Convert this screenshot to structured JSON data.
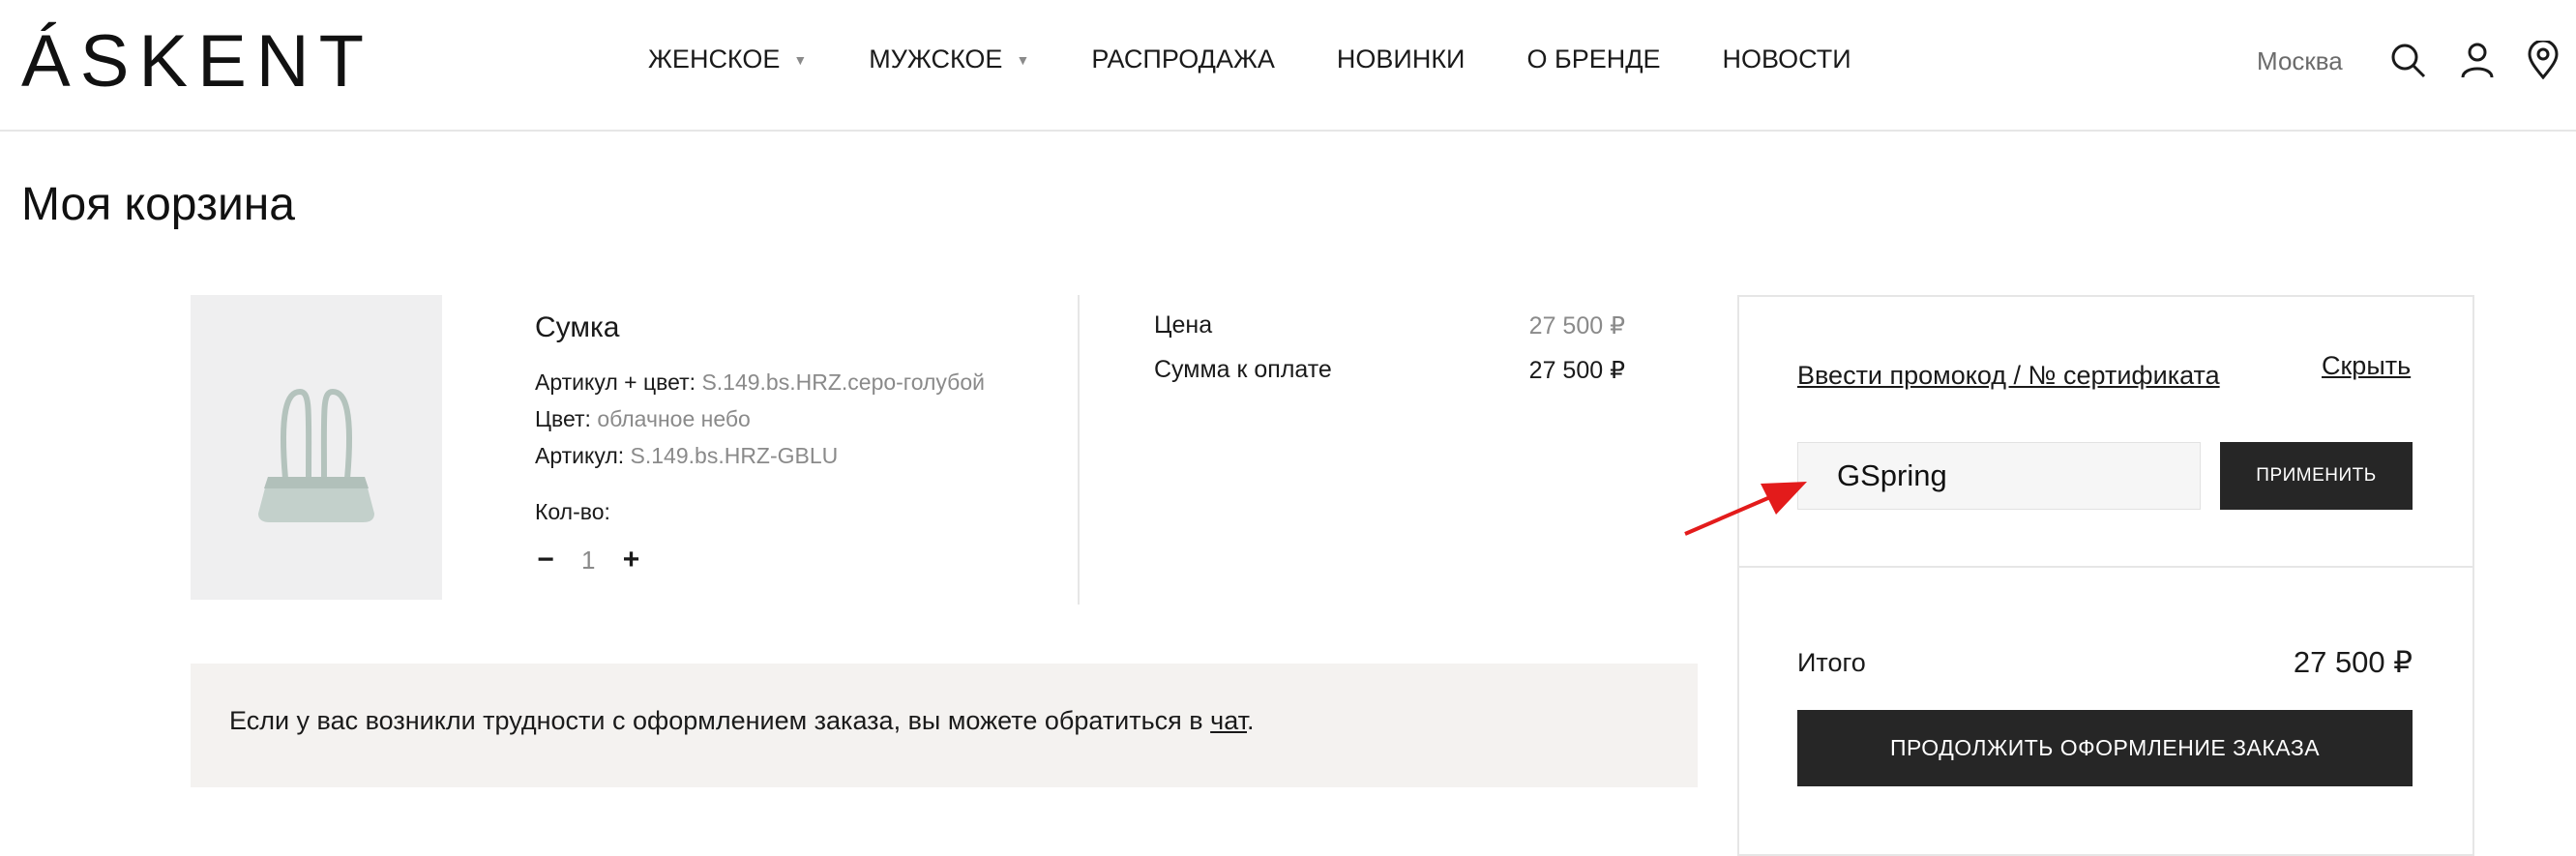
{
  "header": {
    "logo": "ÁSKENT",
    "nav": [
      {
        "label": "ЖЕНСКОЕ",
        "dropdown": true
      },
      {
        "label": "МУЖСКОЕ",
        "dropdown": true
      },
      {
        "label": "РАСПРОДАЖА",
        "dropdown": false
      },
      {
        "label": "НОВИНКИ",
        "dropdown": false
      },
      {
        "label": "О БРЕНДЕ",
        "dropdown": false
      },
      {
        "label": "НОВОСТИ",
        "dropdown": false
      }
    ],
    "city": "Москва",
    "icons": [
      "search-icon",
      "user-icon",
      "location-pin-icon"
    ]
  },
  "page": {
    "title": "Моя корзина"
  },
  "cart_item": {
    "name": "Сумка",
    "rows": [
      {
        "label": "Артикул + цвет:",
        "value": "S.149.bs.HRZ.серо-голубой"
      },
      {
        "label": "Цвет:",
        "value": "облачное небо"
      },
      {
        "label": "Артикул:",
        "value": "S.149.bs.HRZ-GBLU"
      }
    ],
    "qty_label": "Кол-во:",
    "qty_minus": "−",
    "qty_value": "1",
    "qty_plus": "+",
    "price_label": "Цена",
    "price_value": "27 500 ₽",
    "sum_label": "Сумма к оплате",
    "sum_value": "27 500 ₽"
  },
  "help": {
    "text_before": "Если у вас возникли трудности с оформлением заказа, вы можете обратиться в ",
    "link": "чат",
    "text_after": "."
  },
  "summary": {
    "promo_link": "Ввести промокод / № сертификата",
    "hide_link": "Скрыть",
    "promo_value": "GSpring",
    "apply_label": "ПРИМЕНИТЬ",
    "total_label": "Итого",
    "total_value": "27 500 ₽",
    "checkout_label": "ПРОДОЛЖИТЬ ОФОРМЛЕНИЕ ЗАКАЗА"
  },
  "colors": {
    "accent": "#262626",
    "arrow": "#e31b1b",
    "help_bg": "#f4f2f0"
  }
}
